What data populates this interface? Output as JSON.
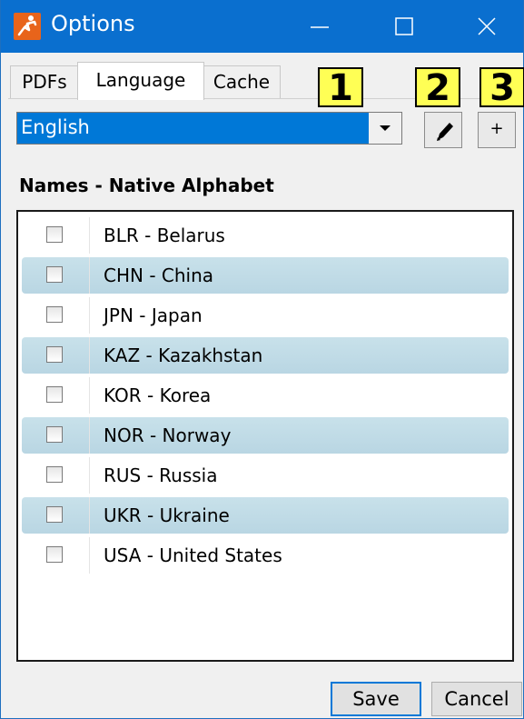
{
  "window": {
    "title": "Options"
  },
  "tabs": [
    {
      "label": "PDFs",
      "active": false
    },
    {
      "label": "Language",
      "active": true
    },
    {
      "label": "Cache",
      "active": false
    }
  ],
  "badges": [
    "1",
    "2",
    "3"
  ],
  "language": {
    "selected": "English"
  },
  "add_button_label": "+",
  "section_label": "Names - Native Alphabet",
  "rows": [
    {
      "label": "BLR - Belarus",
      "checked": false
    },
    {
      "label": "CHN - China",
      "checked": false
    },
    {
      "label": "JPN - Japan",
      "checked": false
    },
    {
      "label": "KAZ - Kazakhstan",
      "checked": false
    },
    {
      "label": "KOR - Korea",
      "checked": false
    },
    {
      "label": "NOR - Norway",
      "checked": false
    },
    {
      "label": "RUS - Russia",
      "checked": false
    },
    {
      "label": "UKR - Ukraine",
      "checked": false
    },
    {
      "label": "USA - United States",
      "checked": false
    }
  ],
  "buttons": {
    "save": "Save",
    "cancel": "Cancel"
  },
  "colors": {
    "titlebar": "#0a6fcf",
    "selection": "#0078d7",
    "badge": "#ffff55",
    "row_alt": "#c8e1ea"
  },
  "icons": [
    "app-icon",
    "minimize-icon",
    "maximize-icon",
    "close-icon",
    "chevron-down-icon",
    "pencil-icon"
  ]
}
